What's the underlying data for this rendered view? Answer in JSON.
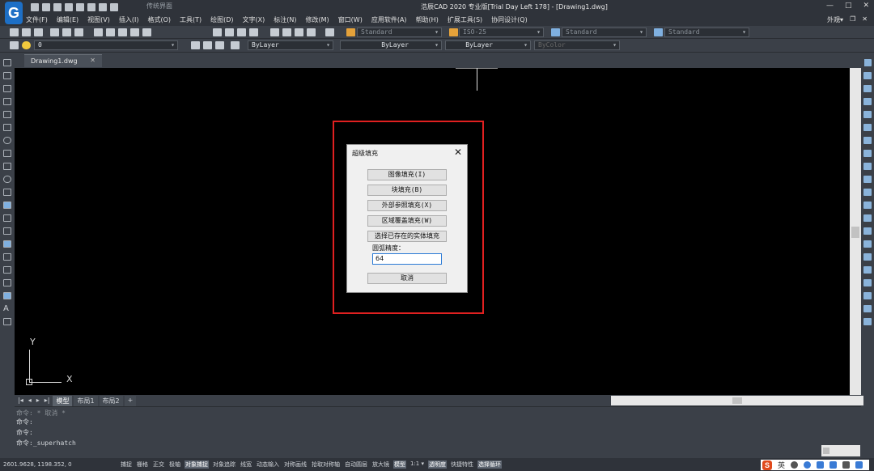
{
  "app": {
    "title": "浩辰CAD 2020 专业版[Trial Day Left 178] - [Drawing1.dwg]",
    "workspace": "传统界面",
    "window_controls": [
      "—",
      "□",
      "✕"
    ]
  },
  "menu": {
    "items": [
      "文件(F)",
      "编辑(E)",
      "视图(V)",
      "插入(I)",
      "格式(O)",
      "工具(T)",
      "绘图(D)",
      "文字(X)",
      "标注(N)",
      "修改(M)",
      "窗口(W)",
      "应用软件(A)",
      "帮助(H)",
      "扩展工具(S)",
      "协同设计(Q)"
    ],
    "appearance": "外观▾",
    "doc_controls": [
      "—",
      "❐",
      "✕"
    ]
  },
  "toolbar": {
    "text_style": "Standard",
    "dim_style": "ISO-25",
    "table_style": "Standard",
    "multileader_style": "Standard",
    "layer": "0",
    "color": "ByLayer",
    "linetype": "ByLayer",
    "lineweight": "ByLayer",
    "plot_style": "ByColor"
  },
  "tabs": {
    "document": "Drawing1.dwg",
    "close": "✕",
    "layouts": [
      "模型",
      "布局1",
      "布局2",
      "+"
    ]
  },
  "ucs": {
    "x_label": "X",
    "y_label": "Y"
  },
  "dialog": {
    "title": "超级填充",
    "close": "✕",
    "buttons": {
      "image_fill": "图像填充(I)",
      "block_fill": "块填充(B)",
      "xref_fill": "外部参照填充(X)",
      "wipeout_fill": "区域覆盖填充(W)",
      "select_existing": "选择已存在的实体填充"
    },
    "arc_precision_label": "圆弧精度：",
    "arc_precision_value": "64",
    "cancel": "取消"
  },
  "command": {
    "lines": [
      "命令: * 取消 *",
      "命令:",
      "命令:",
      "命令:_superhatch"
    ]
  },
  "status": {
    "coords": "2601.9628, 1198.352, 0",
    "items": [
      {
        "label": "捕捉",
        "on": false
      },
      {
        "label": "栅格",
        "on": false
      },
      {
        "label": "正交",
        "on": false
      },
      {
        "label": "极轴",
        "on": false
      },
      {
        "label": "对象捕捉",
        "on": true
      },
      {
        "label": "对象追踪",
        "on": false
      },
      {
        "label": "线宽",
        "on": false
      },
      {
        "label": "动态输入",
        "on": false
      },
      {
        "label": "对称画线",
        "on": false
      },
      {
        "label": "拾取对称轴",
        "on": false
      },
      {
        "label": "自动圆层",
        "on": false
      },
      {
        "label": "放大镜",
        "on": false
      },
      {
        "label": "模型",
        "on": true
      },
      {
        "label": "1:1 ▾",
        "on": false
      },
      {
        "label": "透明度",
        "on": true
      },
      {
        "label": "快捷特性",
        "on": false
      },
      {
        "label": "选择循环",
        "on": true
      }
    ],
    "ime": "英"
  },
  "colors": {
    "highlight": "#e02020",
    "canvas": "#000000",
    "chrome": "#3b4048"
  }
}
